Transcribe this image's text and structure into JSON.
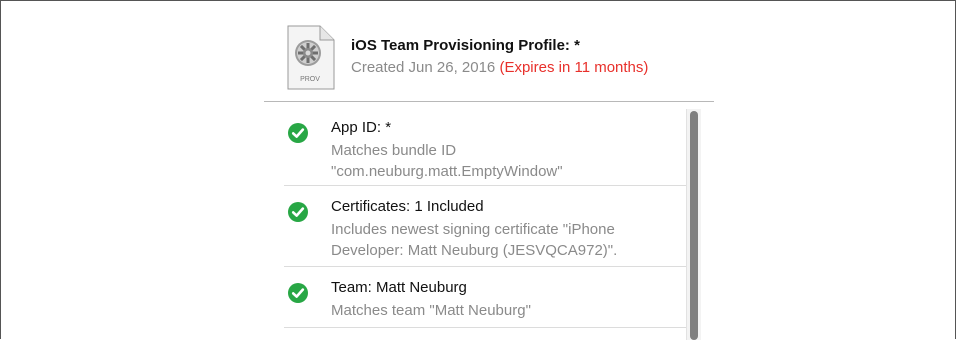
{
  "profile": {
    "icon": "prov-file-icon",
    "icon_label": "PROV",
    "title": "iOS Team Provisioning Profile: *",
    "created": "Created Jun 26, 2016",
    "expires": "(Expires in 11 months)",
    "expires_color": "#e8302b"
  },
  "checks": [
    {
      "icon": "check-circle-icon",
      "title": "App ID: *",
      "desc": [
        "Matches bundle ID",
        "\"com.neuburg.matt.EmptyWindow\""
      ]
    },
    {
      "icon": "check-circle-icon",
      "title": "Certificates: 1 Included",
      "desc": [
        "Includes newest signing certificate \"iPhone",
        "Developer: Matt Neuburg (JESVQCA972)\"."
      ]
    },
    {
      "icon": "check-circle-icon",
      "title": "Team: Matt Neuburg",
      "desc": [
        "Matches team \"Matt Neuburg\""
      ]
    }
  ],
  "colors": {
    "check_green": "#28a745",
    "secondary_text": "#8a8a8a"
  }
}
